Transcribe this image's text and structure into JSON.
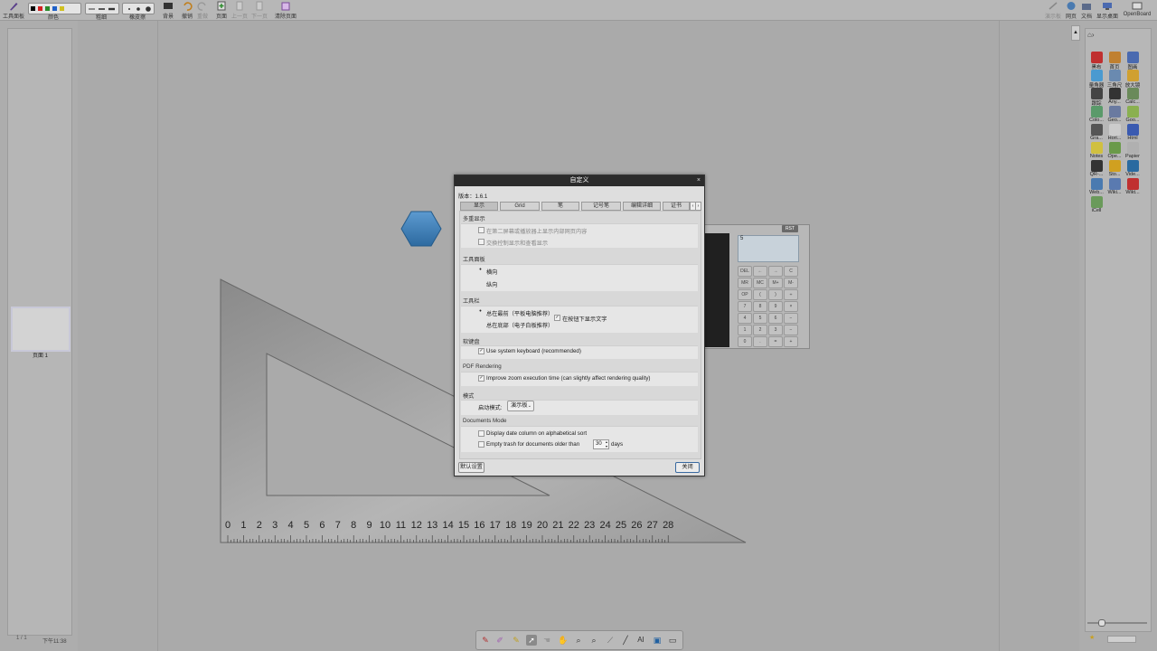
{
  "toolbar": {
    "left_labels": {
      "tool_panel": "工具面板",
      "color": "颜色",
      "thickness": "粗细",
      "eraser": "橡皮擦",
      "background": "背景",
      "undo": "撤销",
      "redo": "重做",
      "page": "页面",
      "prev": "上一页",
      "next": "下一页",
      "clear": "清除页面"
    },
    "right_labels": {
      "show_desktop_dim": "演示板",
      "web": "网页",
      "docs": "文档",
      "show_desktop": "显示桌面",
      "openboard": "OpenBoard"
    },
    "pen_colors": [
      "#000000",
      "#d32020",
      "#2a8a2a",
      "#2060c8",
      "#d0c020"
    ]
  },
  "left_panel": {
    "page_label": "页面 1",
    "page_counter": "1 / 1",
    "clock": "下午11:38"
  },
  "ruler": {
    "ticks": [
      "0",
      "1",
      "2",
      "3",
      "4",
      "5",
      "6",
      "7",
      "8",
      "9",
      "10",
      "11",
      "12",
      "13",
      "14",
      "15",
      "16",
      "17",
      "18",
      "19",
      "20",
      "21",
      "22",
      "23",
      "24",
      "25",
      "26",
      "27",
      "28"
    ]
  },
  "calculator": {
    "rst": "RST",
    "display": "5",
    "keys": [
      [
        "DEL",
        "←",
        "→",
        "C"
      ],
      [
        "MR",
        "MC",
        "M+",
        "M-"
      ],
      [
        "OP",
        "(",
        ")",
        "÷"
      ],
      [
        "7",
        "8",
        "9",
        "×"
      ],
      [
        "4",
        "5",
        "6",
        "−"
      ],
      [
        "1",
        "2",
        "3",
        "−"
      ],
      [
        "0",
        ".",
        "=",
        "+"
      ]
    ]
  },
  "dialog": {
    "title": "自定义",
    "close_x": "×",
    "version_label": "版本：1.6.1",
    "tabs": [
      "显示",
      "Grid",
      "笔",
      "记号笔",
      "编辑详细",
      "证书"
    ],
    "sections": {
      "multi_display": {
        "title": "多重显示",
        "opt1": "在第二屏幕或播放器上显示内部网页内容",
        "opt2": "交换控制显示和查看显示"
      },
      "tool_panel": {
        "title": "工具面板",
        "opt1": "横向",
        "opt2": "纵向"
      },
      "toolbar": {
        "title": "工具栏",
        "opt1": "总在最前（平板电脑推荐）",
        "opt2": "总在底部（电子白板推荐）",
        "opt3": "在按钮下显示文字"
      },
      "keyboard": {
        "title": "软键盘",
        "opt1": "Use system keyboard (recommended)"
      },
      "pdf": {
        "title": "PDF Rendering",
        "opt1": "Improve zoom execution time (can slightly affect rendering quality)"
      },
      "mode": {
        "title": "模式",
        "label": "启动模式:",
        "value": "演示板"
      },
      "documents": {
        "title": "Documents Mode",
        "opt1": "Display date column on alphabetical sort",
        "opt2": "Empty trash for documents older than",
        "days_value": "30",
        "days_unit": "days"
      }
    },
    "default_button": "默认设置",
    "close_button": "关闭"
  },
  "library": {
    "apps": [
      "黑布",
      "首页",
      "图画",
      "量角器",
      "三角尺",
      "放大镜",
      "跟踪",
      "Any...",
      "Calc...",
      "Colo...",
      "Geo...",
      "Goo...",
      "Gra...",
      "Hori...",
      "Html",
      "Notes",
      "Ope...",
      "Papier",
      "QR-...",
      "Sto...",
      "Vide...",
      "Web...",
      "Wiki...",
      "Wikt...",
      "iCell"
    ]
  }
}
